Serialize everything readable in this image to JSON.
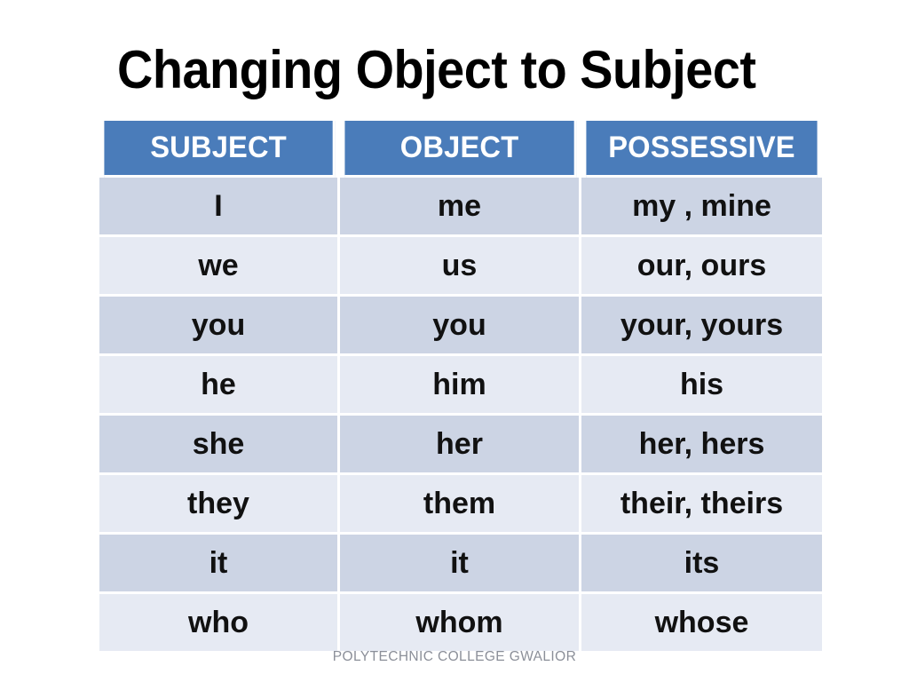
{
  "slide": {
    "title": "Changing Object to Subject",
    "footer": "POLYTECHNIC COLLEGE GWALIOR"
  },
  "colors": {
    "header_blue": "#4a7cba",
    "header_text": "#ffffff",
    "row_dark": "#ccd4e4",
    "row_light": "#e6eaf3",
    "cell_text": "#111111",
    "footer_text": "#8b8f99",
    "background": "#ffffff"
  },
  "table": {
    "headers": [
      "SUBJECT",
      "OBJECT",
      "POSSESSIVE"
    ],
    "rows": [
      {
        "subject": "I",
        "object": "me",
        "possessive": "my , mine"
      },
      {
        "subject": "we",
        "object": "us",
        "possessive": "our, ours"
      },
      {
        "subject": "you",
        "object": "you",
        "possessive": "your, yours"
      },
      {
        "subject": "he",
        "object": "him",
        "possessive": "his"
      },
      {
        "subject": "she",
        "object": "her",
        "possessive": "her, hers"
      },
      {
        "subject": "they",
        "object": "them",
        "possessive": "their, theirs"
      },
      {
        "subject": "it",
        "object": "it",
        "possessive": "its"
      },
      {
        "subject": "who",
        "object": "whom",
        "possessive": "whose"
      }
    ]
  }
}
